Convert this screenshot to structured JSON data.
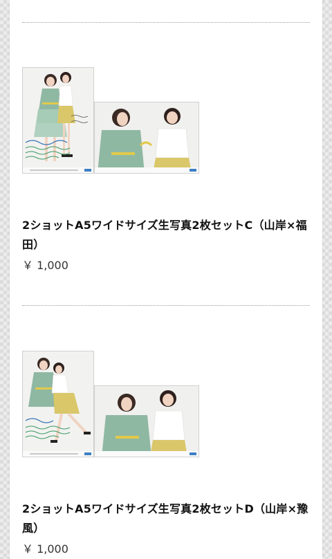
{
  "products": [
    {
      "title": "2ショットA5ワイドサイズ生写真2枚セットC（山岸×福田）",
      "price": "￥ 1,000",
      "thumbnail_icon": "photo-set-thumbnail"
    },
    {
      "title": "2ショットA5ワイドサイズ生写真2枚セットD（山岸×豫風）",
      "price": "￥ 1,000",
      "thumbnail_icon": "photo-set-thumbnail"
    }
  ],
  "colors": {
    "page_background": "#ececec",
    "content_background": "#ffffff",
    "title_text": "#111111",
    "price_text": "#333333",
    "divider": "#9a9a9a",
    "dress_green": "#8fb8a3",
    "skirt_yellow": "#d9c76a"
  }
}
